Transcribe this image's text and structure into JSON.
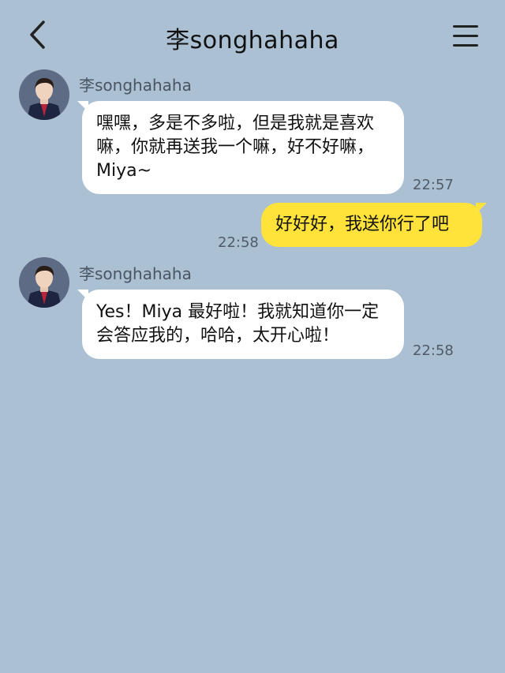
{
  "header": {
    "title": "李songhahaha",
    "back_icon": "chevron-left-icon",
    "menu_icon": "hamburger-menu-icon"
  },
  "messages": [
    {
      "direction": "incoming",
      "sender": "李songhahaha",
      "text": "嘿嘿，多是不多啦，但是我就是喜欢嘛，你就再送我一个嘛，好不好嘛，Miya~",
      "time": "22:57"
    },
    {
      "direction": "outgoing",
      "text": "好好好，我送你行了吧",
      "time": "22:58"
    },
    {
      "direction": "incoming",
      "sender": "李songhahaha",
      "text": "Yes！Miya 最好啦！我就知道你一定会答应我的，哈哈，太开心啦！",
      "time": "22:58"
    }
  ],
  "colors": {
    "background": "#abc1d3",
    "incoming_bubble": "#ffffff",
    "outgoing_bubble": "#ffe33b"
  }
}
